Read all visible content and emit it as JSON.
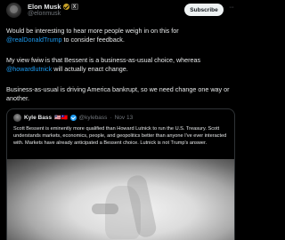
{
  "author": {
    "name": "Elon Musk",
    "handle": "@elonmusk",
    "verified_color": "#c9a227",
    "org_badge_icon": "x-logo-badge-icon"
  },
  "actions": {
    "subscribe_label": "Subscribe",
    "more_label": "···"
  },
  "post": {
    "p1_pre": "Would be interesting to hear more people weigh in on this for ",
    "p1_mention": "@realDonaldTrump",
    "p1_post": " to consider feedback.",
    "p2_pre": "My view fwiw is that Bessent is a business-as-usual choice, whereas ",
    "p2_mention": "@howardlutnick",
    "p2_post": " will actually enact change.",
    "p3": "Business-as-usual is driving America bankrupt, so we need change one way or another."
  },
  "quote": {
    "name": "Kyle Bass",
    "flags": "🇺🇸🇹🇼",
    "handle": "@kylebass",
    "separator": "·",
    "date": "Nov 13",
    "text": "Scott Bessent is eminently more qualified than Howard Lutnick to run the U.S. Treasury. Scott understands markets, economics, people, and geopolitics better than anyone I've ever interacted with. Markets have already anticipated a Bessent choice. Lutnick is not Trump's answer.",
    "verified_color": "#1d9bf0"
  },
  "colors": {
    "background": "#000000",
    "text": "#e7e9ea",
    "mention": "#1d9bf0",
    "muted": "#71767b"
  }
}
